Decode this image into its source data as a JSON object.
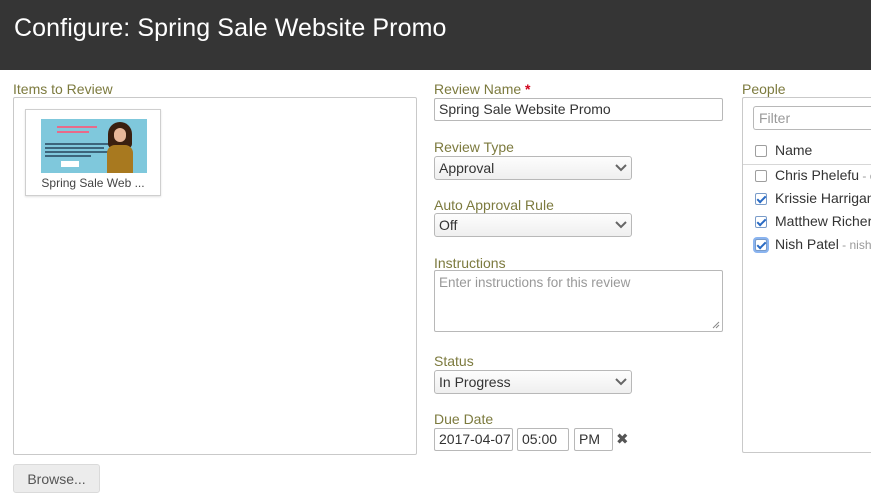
{
  "header": {
    "title": "Configure: Spring Sale Website Promo"
  },
  "items": {
    "label": "Items to Review",
    "thumbnail": {
      "caption": "Spring Sale Web ..."
    },
    "browse_label": "Browse..."
  },
  "form": {
    "review_name": {
      "label": "Review Name",
      "required_mark": "*",
      "value": "Spring Sale Website Promo"
    },
    "review_type": {
      "label": "Review Type",
      "value": "Approval"
    },
    "auto_approval": {
      "label": "Auto Approval Rule",
      "value": "Off"
    },
    "instructions": {
      "label": "Instructions",
      "placeholder": "Enter instructions for this review"
    },
    "status": {
      "label": "Status",
      "value": "In Progress"
    },
    "due_date": {
      "label": "Due Date",
      "date": "2017-04-07",
      "time": "05:00",
      "ampm": "PM",
      "clear_icon": "close-icon"
    }
  },
  "people": {
    "label": "People",
    "filter_placeholder": "Filter",
    "column_header": "Name",
    "rows": [
      {
        "name": "Chris Phelefu",
        "sub": " - c",
        "checked": false
      },
      {
        "name": "Krissie Harrigan",
        "sub": "",
        "checked": true
      },
      {
        "name": "Matthew Richer",
        "sub": "",
        "checked": true
      },
      {
        "name": "Nish Patel",
        "sub": " - nish",
        "checked": true
      }
    ]
  },
  "colors": {
    "header_bg": "#353535",
    "label": "#7c7a3e",
    "required": "#d0021b",
    "check": "#2a6bc4"
  }
}
